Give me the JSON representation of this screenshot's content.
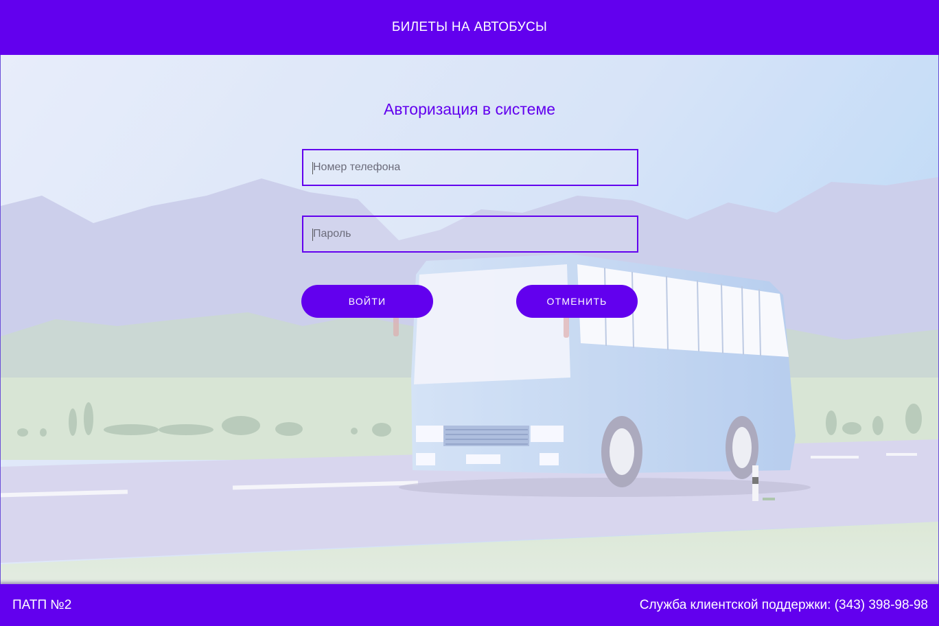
{
  "header": {
    "title": "БИЛЕТЫ НА АВТОБУСЫ"
  },
  "login": {
    "title": "Авторизация в системе",
    "phone_placeholder": "Номер телефона",
    "password_placeholder": "Пароль",
    "login_button": "ВОЙТИ",
    "cancel_button": "ОТМЕНИТЬ"
  },
  "footer": {
    "org": "ПАТП №2",
    "support_label": "Служба клиентской поддержки:",
    "support_phone": "(343) 398-98-98"
  },
  "colors": {
    "accent": "#6200ee",
    "on_accent": "#ffffff"
  }
}
